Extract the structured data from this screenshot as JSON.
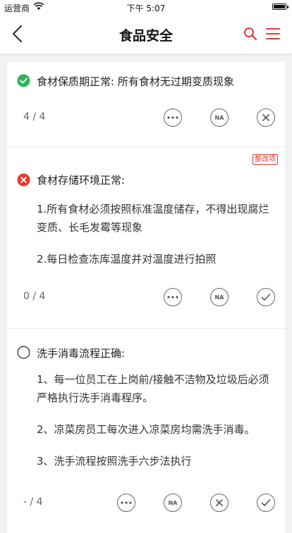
{
  "status_bar": {
    "carrier": "运营商",
    "time": "下午 5:07"
  },
  "nav": {
    "title": "食品安全"
  },
  "colors": {
    "accent": "#e53935",
    "ok": "#2db45b",
    "icon": "#666666"
  },
  "items": [
    {
      "status": "ok",
      "title": "食材保质期正常: 所有食材无过期变质现象",
      "score": "4 / 4",
      "actions": [
        "more",
        "na",
        "close"
      ]
    },
    {
      "status": "fail",
      "tag": "整改项",
      "title": "食材存储环境正常:",
      "desc_lines": [
        "1.所有食材必须按照标准温度储存，不得出现腐烂变质、长毛发霉等现象",
        "2.每日检查冻库温度并对温度进行拍照"
      ],
      "score": "0 / 4",
      "actions": [
        "more",
        "na",
        "check"
      ]
    },
    {
      "status": "pending",
      "title": "洗手消毒流程正确:",
      "desc_lines": [
        "1、每一位员工在上岗前/接触不洁物及垃圾后必须严格执行洗手消毒程序。",
        "2、凉菜房员工每次进入凉菜房均需洗手消毒。",
        "3、洗手流程按照洗手六步法执行"
      ],
      "score": "- / 4",
      "actions": [
        "more",
        "na",
        "close",
        "check"
      ]
    }
  ],
  "icons": {
    "na_label": "NA",
    "names": [
      "back-icon",
      "search-icon",
      "menu-icon",
      "check-circle-icon",
      "error-circle-icon",
      "empty-circle-icon",
      "more-icon",
      "na-icon",
      "close-icon",
      "check-icon"
    ]
  }
}
